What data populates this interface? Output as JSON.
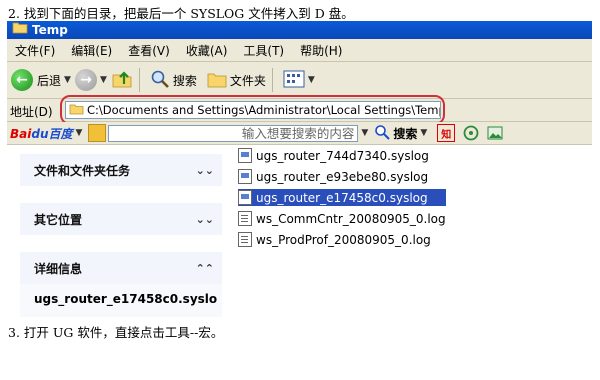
{
  "doc": {
    "step2": "2.   找到下面的目录，把最后一个 SYSLOG 文件拷入到 D 盘。",
    "step3": "3.   打开 UG 软件，直接点击工具--宏。"
  },
  "window": {
    "title": "Temp"
  },
  "menu": [
    "文件(F)",
    "编辑(E)",
    "查看(V)",
    "收藏(A)",
    "工具(T)",
    "帮助(H)"
  ],
  "toolbar": {
    "back_label": "后退",
    "search_label": "搜索",
    "folders_label": "文件夹"
  },
  "address": {
    "label": "地址(D)",
    "path": "C:\\Documents and Settings\\Administrator\\Local Settings\\Temp"
  },
  "baidu": {
    "logo_a": "Bai",
    "logo_b": "du百度",
    "input_placeholder": "输入想要搜索的内容",
    "search_label": "搜索"
  },
  "tasks": {
    "file_tasks": "文件和文件夹任务",
    "other_places": "其它位置",
    "details": "详细信息",
    "details_filename": "ugs_router_e17458c0.syslo"
  },
  "files": [
    {
      "name": "ugs_router_744d7340.syslog",
      "type": "syslog",
      "selected": false
    },
    {
      "name": "ugs_router_e93ebe80.syslog",
      "type": "syslog",
      "selected": false
    },
    {
      "name": "ugs_router_e17458c0.syslog",
      "type": "syslog",
      "selected": true
    },
    {
      "name": "ws_CommCntr_20080905_0.log",
      "type": "log",
      "selected": false
    },
    {
      "name": "ws_ProdProf_20080905_0.log",
      "type": "log",
      "selected": false
    }
  ],
  "colors": {
    "titlebar": "#0a5bd8",
    "highlight_outline": "#d0303a",
    "selection": "#2a4fbb"
  }
}
